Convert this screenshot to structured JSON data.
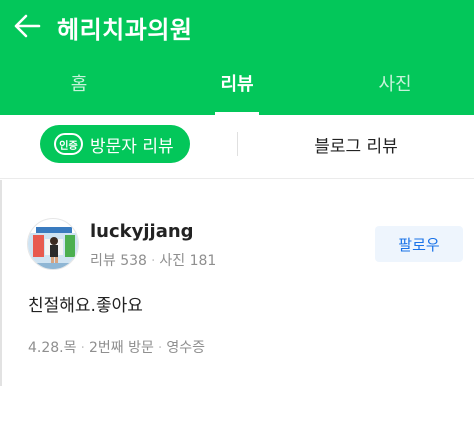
{
  "appbar": {
    "title": "헤리치과의원",
    "back_icon": "arrow-left-icon"
  },
  "tabs": [
    {
      "label": "홈",
      "active": false
    },
    {
      "label": "리뷰",
      "active": true
    },
    {
      "label": "사진",
      "active": false
    }
  ],
  "subtabs": {
    "visitor_badge": "인증",
    "visitor_label": "방문자 리뷰",
    "blog_label": "블로그 리뷰"
  },
  "review": {
    "nickname": "luckyjjang",
    "stat_reviews": "리뷰 538",
    "stat_photos": "사진 181",
    "follow_label": "팔로우",
    "text": "친절해요.좋아요",
    "visit_date": "4.28.목",
    "visit_count": "2번째 방문",
    "receipt": "영수증"
  },
  "colors": {
    "brand": "#03c75a",
    "follow_text": "#1a73e8",
    "follow_bg": "#eef5fd"
  }
}
